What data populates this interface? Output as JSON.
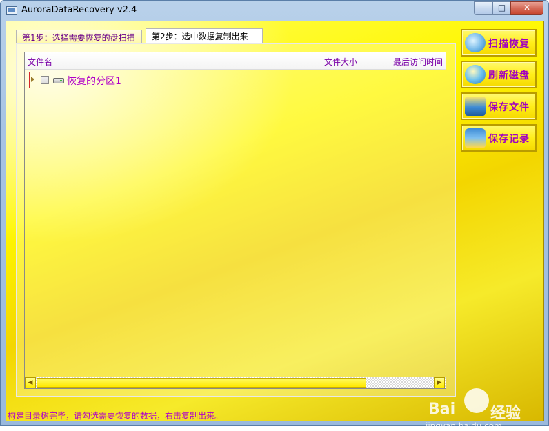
{
  "window": {
    "title": "AuroraDataRecovery v2.4",
    "controls": {
      "minimize": "—",
      "maximize": "□",
      "close": "✕"
    }
  },
  "tabs": [
    {
      "label": "第1步：选择需要恢复的盘扫描",
      "selected": false
    },
    {
      "label": "第2步：选中数据复制出来",
      "selected": true
    }
  ],
  "tree": {
    "columns": [
      "文件名",
      "文件大小",
      "最后访问时间"
    ],
    "rows": [
      {
        "label": "恢复的分区1",
        "checked": false,
        "expanded": false,
        "icon": "drive-icon"
      }
    ],
    "scroll": {
      "left": "◀",
      "right": "▶"
    }
  },
  "actions": [
    {
      "label": "扫描恢复",
      "icon": "scan-globe-icon"
    },
    {
      "label": "刷新磁盘",
      "icon": "refresh-lightbulb-icon"
    },
    {
      "label": "保存文件",
      "icon": "save-folder-icon"
    },
    {
      "label": "保存记录",
      "icon": "save-record-icon"
    }
  ],
  "status": {
    "text": "构建目录树完毕，请勾选需要恢复的数据，右击复制出来。"
  },
  "watermark": {
    "brand": "Bai",
    "brand_cn": "经验",
    "url": "jingyan.baidu.com"
  },
  "colors": {
    "accent_text": "#b000c8",
    "background": "#ffee00",
    "highlight_border": "#d62828"
  }
}
